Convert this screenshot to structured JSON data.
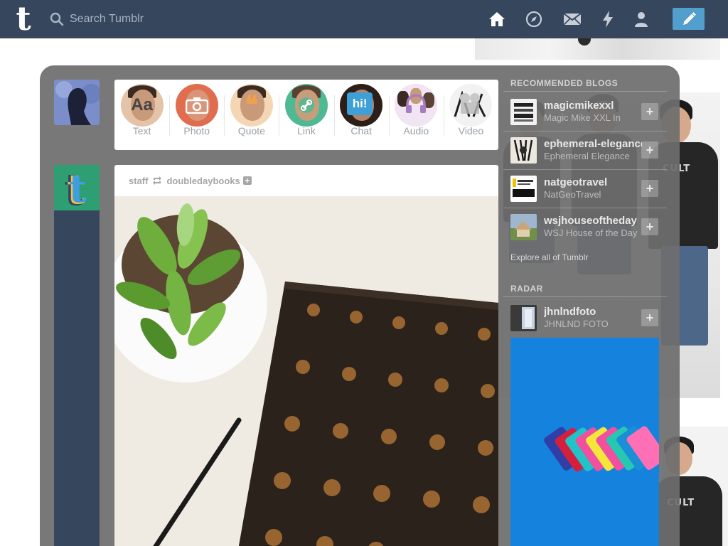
{
  "topbar": {
    "logo": "t",
    "search_placeholder": "Search Tumblr",
    "nav": [
      "home-icon",
      "compass-icon",
      "mail-icon",
      "lightning-icon",
      "person-icon"
    ],
    "compose": "pencil-icon"
  },
  "post_types": [
    {
      "label": "Text",
      "glyph": "Aa",
      "color": "#444444"
    },
    {
      "label": "Photo",
      "glyph": "",
      "color": "#e06e4e"
    },
    {
      "label": "Quote",
      "glyph": "",
      "color": "#f0a24b"
    },
    {
      "label": "Link",
      "glyph": "",
      "color": "#4fb993"
    },
    {
      "label": "Chat",
      "glyph": "hi!",
      "color": "#3ea0d6"
    },
    {
      "label": "Audio",
      "glyph": "",
      "color": "#a77dc2"
    },
    {
      "label": "Video",
      "glyph": "",
      "color": "#888888"
    }
  ],
  "post": {
    "author": "staff",
    "reblogged_from": "doubledaybooks"
  },
  "sidebar": {
    "recommended_title": "RECOMMENDED BLOGS",
    "blogs": [
      {
        "name": "magicmikexxl",
        "title": "Magic Mike XXL In"
      },
      {
        "name": "ephemeral-elegance",
        "title": "Ephemeral Elegance"
      },
      {
        "name": "natgeotravel",
        "title": "NatGeoTravel"
      },
      {
        "name": "wsjhouseoftheday",
        "title": "WSJ House of the Day"
      }
    ],
    "explore": "Explore all of Tumblr",
    "radar_title": "RADAR",
    "radar": {
      "name": "jhnlndfoto",
      "title": "JHNLND FOTO"
    },
    "follow_label": "+"
  },
  "colors": {
    "nav": "#36465d",
    "accent": "#529ecc",
    "panel": "#6e6e6e"
  }
}
